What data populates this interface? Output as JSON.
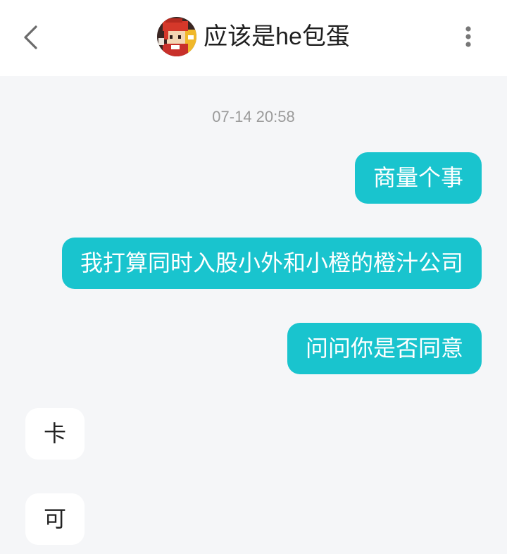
{
  "header": {
    "title": "应该是he包蛋",
    "back_icon": "chevron-left-icon",
    "menu_icon": "more-vertical-icon"
  },
  "chat": {
    "timestamp": "07-14 20:58",
    "messages": [
      {
        "direction": "outgoing",
        "text": "商量个事"
      },
      {
        "direction": "outgoing",
        "text": "我打算同时入股小外和小橙的橙汁公司"
      },
      {
        "direction": "outgoing",
        "text": "问问你是否同意"
      },
      {
        "direction": "incoming",
        "text": "卡"
      },
      {
        "direction": "incoming",
        "text": "可"
      }
    ]
  },
  "colors": {
    "outgoing_bubble": "#19c4ce",
    "incoming_bubble": "#ffffff",
    "background": "#f5f6f8",
    "header": "#ffffff",
    "timestamp_text": "#9a9a9a"
  }
}
